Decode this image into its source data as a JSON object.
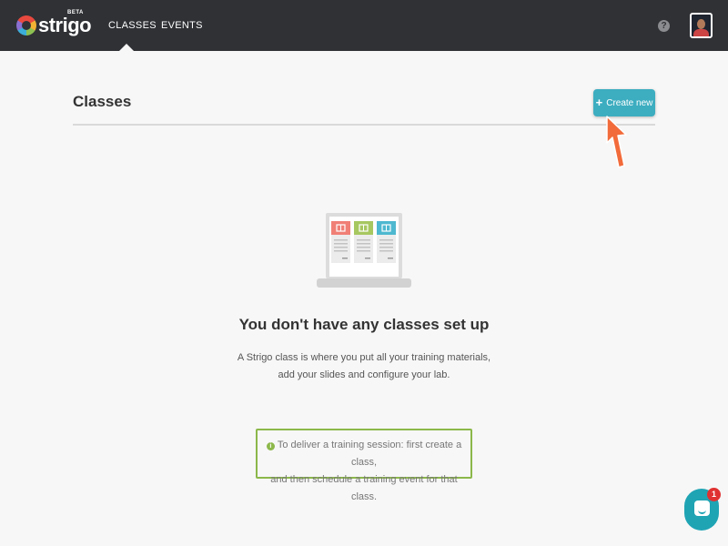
{
  "brand": {
    "name": "strigo",
    "badge": "BETA"
  },
  "nav": {
    "items": [
      {
        "label": "CLASSES",
        "active": true
      },
      {
        "label": "EVENTS",
        "active": false
      }
    ]
  },
  "header_icons": {
    "help": "?"
  },
  "page": {
    "title": "Classes",
    "create_button": "Create new",
    "create_icon": "+"
  },
  "empty_state": {
    "title": "You don't have any classes set up",
    "description_line1": "A Strigo class is where you put all your training materials,",
    "description_line2": "add your slides and configure your lab."
  },
  "tip": {
    "icon": "i",
    "line1": "To deliver a training session: first create a class,",
    "line2": "and then schedule a training event for that class."
  },
  "chat": {
    "badge_count": "1"
  },
  "colors": {
    "topbar": "#2f3135",
    "accent": "#3dadc0",
    "tip_border": "#8cb84a",
    "card_red": "#f07f76",
    "card_green": "#a7c760",
    "card_blue": "#4eb8d0",
    "cursor": "#f26b3a"
  }
}
